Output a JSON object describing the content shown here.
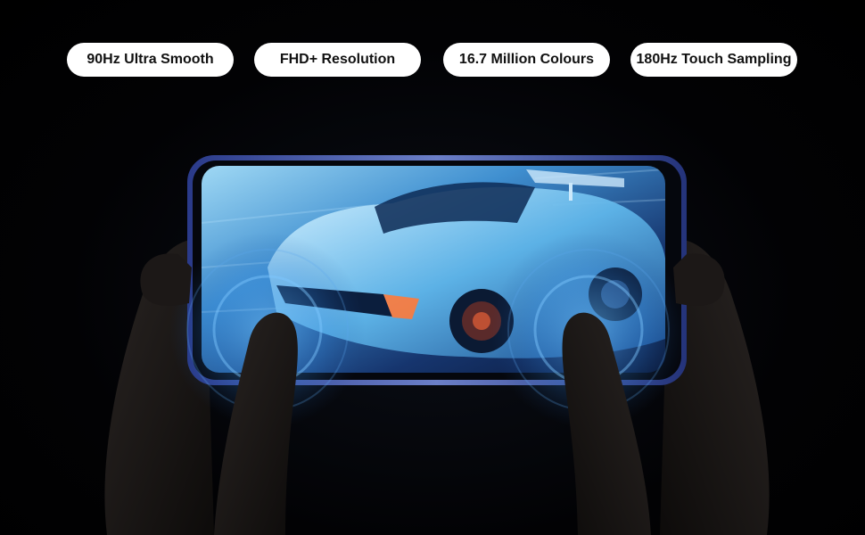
{
  "features": [
    {
      "label": "90Hz Ultra Smooth"
    },
    {
      "label": "FHD+ Resolution"
    },
    {
      "label": "16.7 Million Colours"
    },
    {
      "label": "180Hz Touch Sampling"
    }
  ],
  "colors": {
    "background": "#000000",
    "pill_bg": "#ffffff",
    "pill_text": "#111111",
    "screen_glow": "#3aa8e8",
    "phone_frame": "#1a2a6a"
  },
  "illustration": {
    "subject": "hands-holding-phone-landscape",
    "screen_content": "racing-car-render",
    "touch_indicators": 2
  }
}
